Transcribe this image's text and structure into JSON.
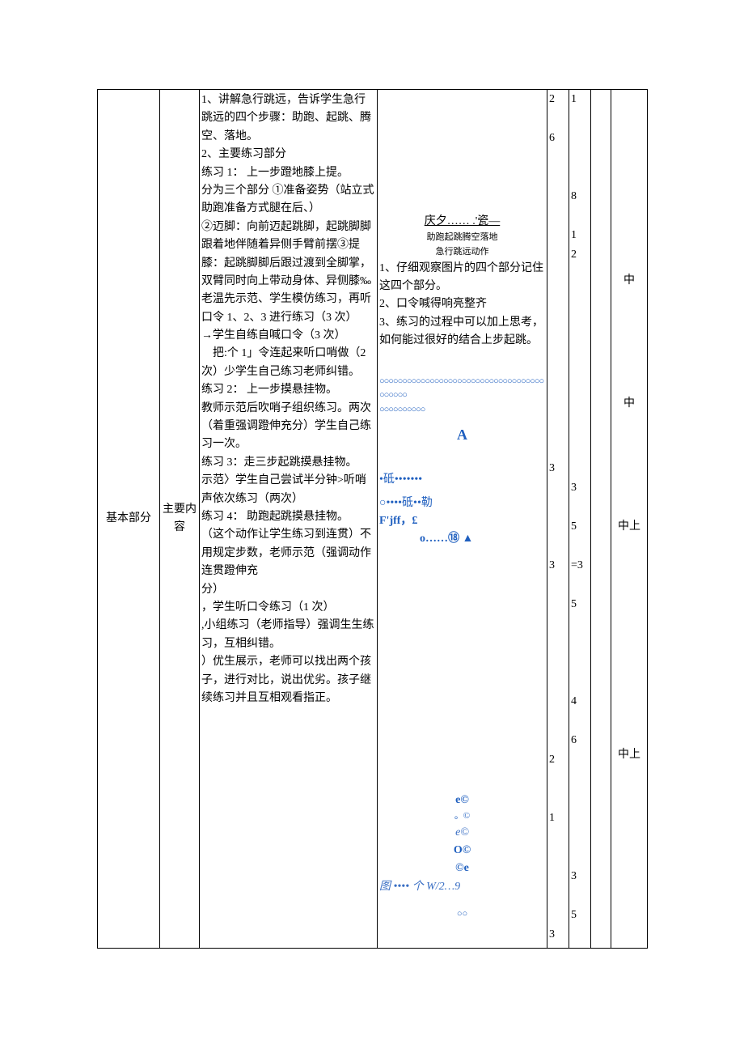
{
  "section": "基本部分",
  "subsection": "主要内容",
  "teach_col": {
    "p1": "1、讲解急行跳远，告诉学生急行跳远的四个步骤：助跑、起跳、腾空、落地。",
    "p2": "2、主要练习部分",
    "ex1_title": "练习 1： 上一步蹬地膝上提。",
    "ex1_a": "分为三个部分 ①准备姿势（站立式助跑准备方式腿在后、）",
    "ex1_b": "②迈脚：向前迈起跳脚，起跳脚脚跟着地伴随着异侧手臂前摆③提膝：起跳脚脚后跟过渡到全脚掌，双臂同时向上带动身体、异侧膝‰老温先示范、学生模仿练习，再听口令 1、2、3 进行练习（3 次）",
    "ex1_c": "→学生自练自喊口令（3 次）",
    "ex1_d": "    把:个 1」令连起来听口哨做（2 次）少学生自己练习老师纠错。",
    "ex2_title": "练习 2： 上一步摸悬挂物。",
    "ex2_a": "教师示范后吹哨子组织练习。两次（着重强调蹬伸充分）学生自己练习一次。",
    "ex3_title": "练习 3：走三步起跳摸悬挂物。",
    "ex3_a": "示范〉学生自己尝试半分钟>听哨声依次练习（两次）",
    "ex4_title": "练习 4： 助跑起跳摸悬挂物。",
    "ex4_a": "（这个动作让学生练习到连贯）不用规定步数，老师示范（强调动作连贯蹬伸充\n分）",
    "ex4_b": "，学生听口令练习（1 次）",
    "ex4_c": ",小组练习（老师指导）强调生生练习，互相纠错。",
    "ex4_d": "）优生展示，老师可以找出两个孩子，进行对比，说出优劣。孩子继续练习并且互相观看指正。"
  },
  "student_col": {
    "diag_top_1": "庆夕…… .'瓷—",
    "diag_top_2": "助跑起跳腾空落地",
    "diag_top_3": "急行跳远动作",
    "s1": "1、仔细观察图片的四个部分记住这四个部分。",
    "s2": "2、口令喊得响亮整齐",
    "s3": "3、练习的过程中可以加上思考，如何能过很好的结合上步起跳。",
    "circles_row1": "○○○○○○○○○○○○○○○○○○○○○○○○○○○○○○○○○○○○○○○○○○",
    "circles_row2": "○○○○○○○○○○",
    "letter_A": "A",
    "mid1": "•砥•••••••",
    "mid2": "○••••砥••勒",
    "mid3": "F'jff，£",
    "mid4": "o……⑱ ▲",
    "bot_e1": "e©",
    "bot_dot": "。©",
    "bot_e2": "e©",
    "bot_O": "O©",
    "bot_ce": "©e",
    "bot_caption": "图 •••• 个 W/2…9",
    "bot_oo": "○○"
  },
  "nums_a": [
    "2",
    "",
    "6",
    "",
    "",
    "",
    "",
    "",
    "",
    "",
    "",
    "",
    "",
    "",
    "",
    "",
    "",
    "",
    "",
    "3",
    "",
    "",
    "",
    "",
    "3",
    "",
    "",
    "",
    "",
    "",
    "",
    "",
    "",
    "",
    "2",
    "",
    "",
    "1",
    "",
    "",
    "",
    "",
    "",
    "3"
  ],
  "nums_b": [
    "1",
    "",
    "",
    "",
    "",
    "8",
    "",
    "1",
    "2",
    "",
    "",
    "",
    "",
    "",
    "",
    "",
    "",
    "",
    "",
    "",
    "3",
    "",
    "5",
    "",
    "3",
    "",
    "5",
    "",
    "",
    "",
    "",
    "4",
    "",
    "6",
    "",
    "",
    "",
    "",
    "",
    "",
    "3",
    "",
    "5",
    ""
  ],
  "nums_b_eq_index": 24,
  "intensity": [
    "中",
    "",
    "中",
    "",
    "中上",
    "",
    "",
    "中上"
  ]
}
